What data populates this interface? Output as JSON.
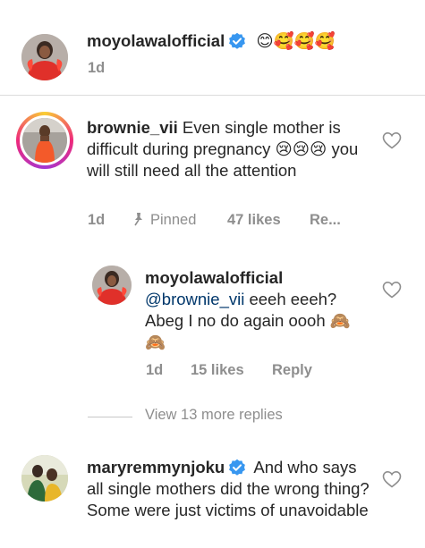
{
  "comments": [
    {
      "username": "moyolawalofficial",
      "verified": true,
      "text": "😊🥰🥰🥰",
      "time": "1d"
    },
    {
      "username": "brownie_vii",
      "verified": false,
      "text": " Even single mother is difficult during pregnancy 😢😢😢 you will still need all the attention",
      "time": "1d",
      "pinned_label": "Pinned",
      "likes": "47 likes",
      "reply": "Re..."
    },
    {
      "username": "moyolawalofficial",
      "verified": true,
      "mention": "@brownie_vii",
      "text": " eeeh eeeh? Abeg I no do again oooh 🙈🙈",
      "time": "1d",
      "likes": "15 likes",
      "reply": "Reply"
    },
    {
      "username": "maryremmynjoku",
      "verified": true,
      "text": "And who says all single mothers did the wrong thing? Some were just victims of unavoidable"
    }
  ],
  "view_more": "View 13 more replies",
  "colors": {
    "verified": "#3897f0",
    "mention": "#00376b",
    "meta": "#8e8e8e",
    "text": "#262626"
  },
  "icons": [
    "verified-badge-icon",
    "heart-outline-icon",
    "pin-icon"
  ]
}
